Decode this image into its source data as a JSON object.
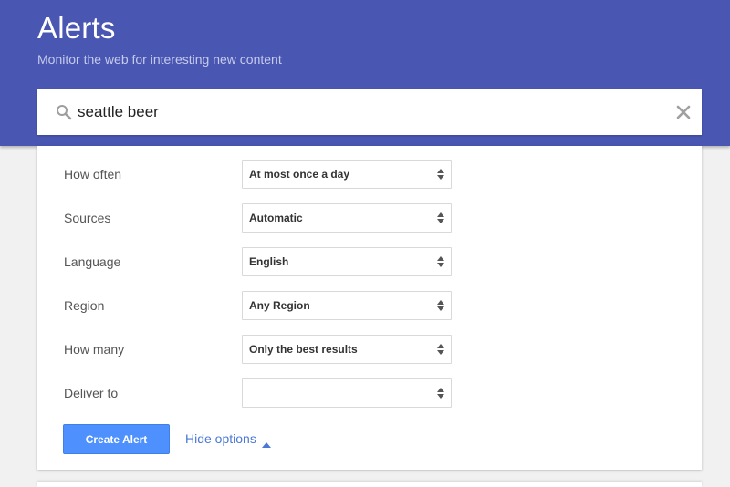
{
  "header": {
    "title": "Alerts",
    "subtitle": "Monitor the web for interesting new content",
    "background_color": "#4956b2"
  },
  "search": {
    "value": "seattle beer",
    "icon": "search-icon",
    "clear_icon": "close-icon"
  },
  "options": {
    "rows": [
      {
        "label": "How often",
        "value": "At most once a day"
      },
      {
        "label": "Sources",
        "value": "Automatic"
      },
      {
        "label": "Language",
        "value": "English"
      },
      {
        "label": "Region",
        "value": "Any Region"
      },
      {
        "label": "How many",
        "value": "Only the best results"
      },
      {
        "label": "Deliver to",
        "value": ""
      }
    ]
  },
  "actions": {
    "create_label": "Create Alert",
    "hide_options_label": "Hide options",
    "create_color": "#4d90fe",
    "link_color": "#4a78d4"
  }
}
